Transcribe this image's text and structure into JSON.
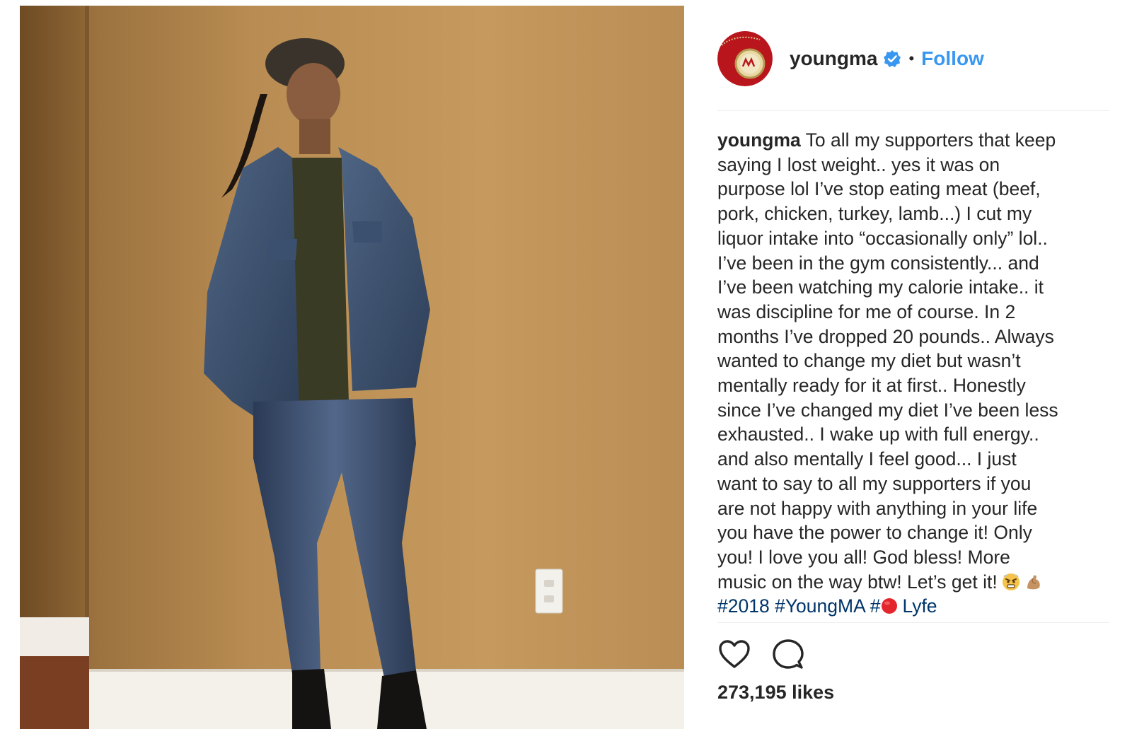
{
  "post": {
    "author": {
      "username": "youngma",
      "verified": true
    },
    "header": {
      "separator": "•",
      "follow_label": "Follow"
    },
    "caption": {
      "username": "youngma",
      "lines": [
        " To all my supporters that keep",
        "saying I lost weight.. yes it was on",
        "purpose lol I’ve stop eating meat (beef,",
        "pork, chicken, turkey, lamb...) I cut my",
        "liquor intake into “occasionally only” lol..",
        "I’ve been in the gym consistently... and",
        "I’ve been watching my calorie intake.. it",
        "was discipline for me of course. In 2",
        "months I’ve dropped 20 pounds.. Always",
        "wanted to change my diet but wasn’t",
        "mentally ready for it at first.. Honestly",
        "since I’ve changed my diet I’ve been less",
        "exhausted.. I wake up with full energy..",
        "and also mentally I feel good... I just",
        "want to say to all my supporters if you",
        "are not happy with anything in your life",
        "you have the power to change it! Only",
        "you! I love you all! God bless! More"
      ],
      "last_line": "music on the way btw! Let’s get it!",
      "emojis": [
        "angry-face-emoji",
        "flexed-biceps-emoji"
      ],
      "hashtags": {
        "tag1": "#2018",
        "tag2": "#YoungMA",
        "tag3_prefix": "#",
        "tag3_suffix": "Lyfe"
      }
    },
    "actions": {
      "like_icon": "heart-icon",
      "comment_icon": "comment-icon"
    },
    "likes_text": "273,195 likes"
  },
  "colors": {
    "link": "#3897f0",
    "hashtag": "#003569",
    "text": "#262626",
    "verified": "#3897f0",
    "divider": "#efefef"
  }
}
